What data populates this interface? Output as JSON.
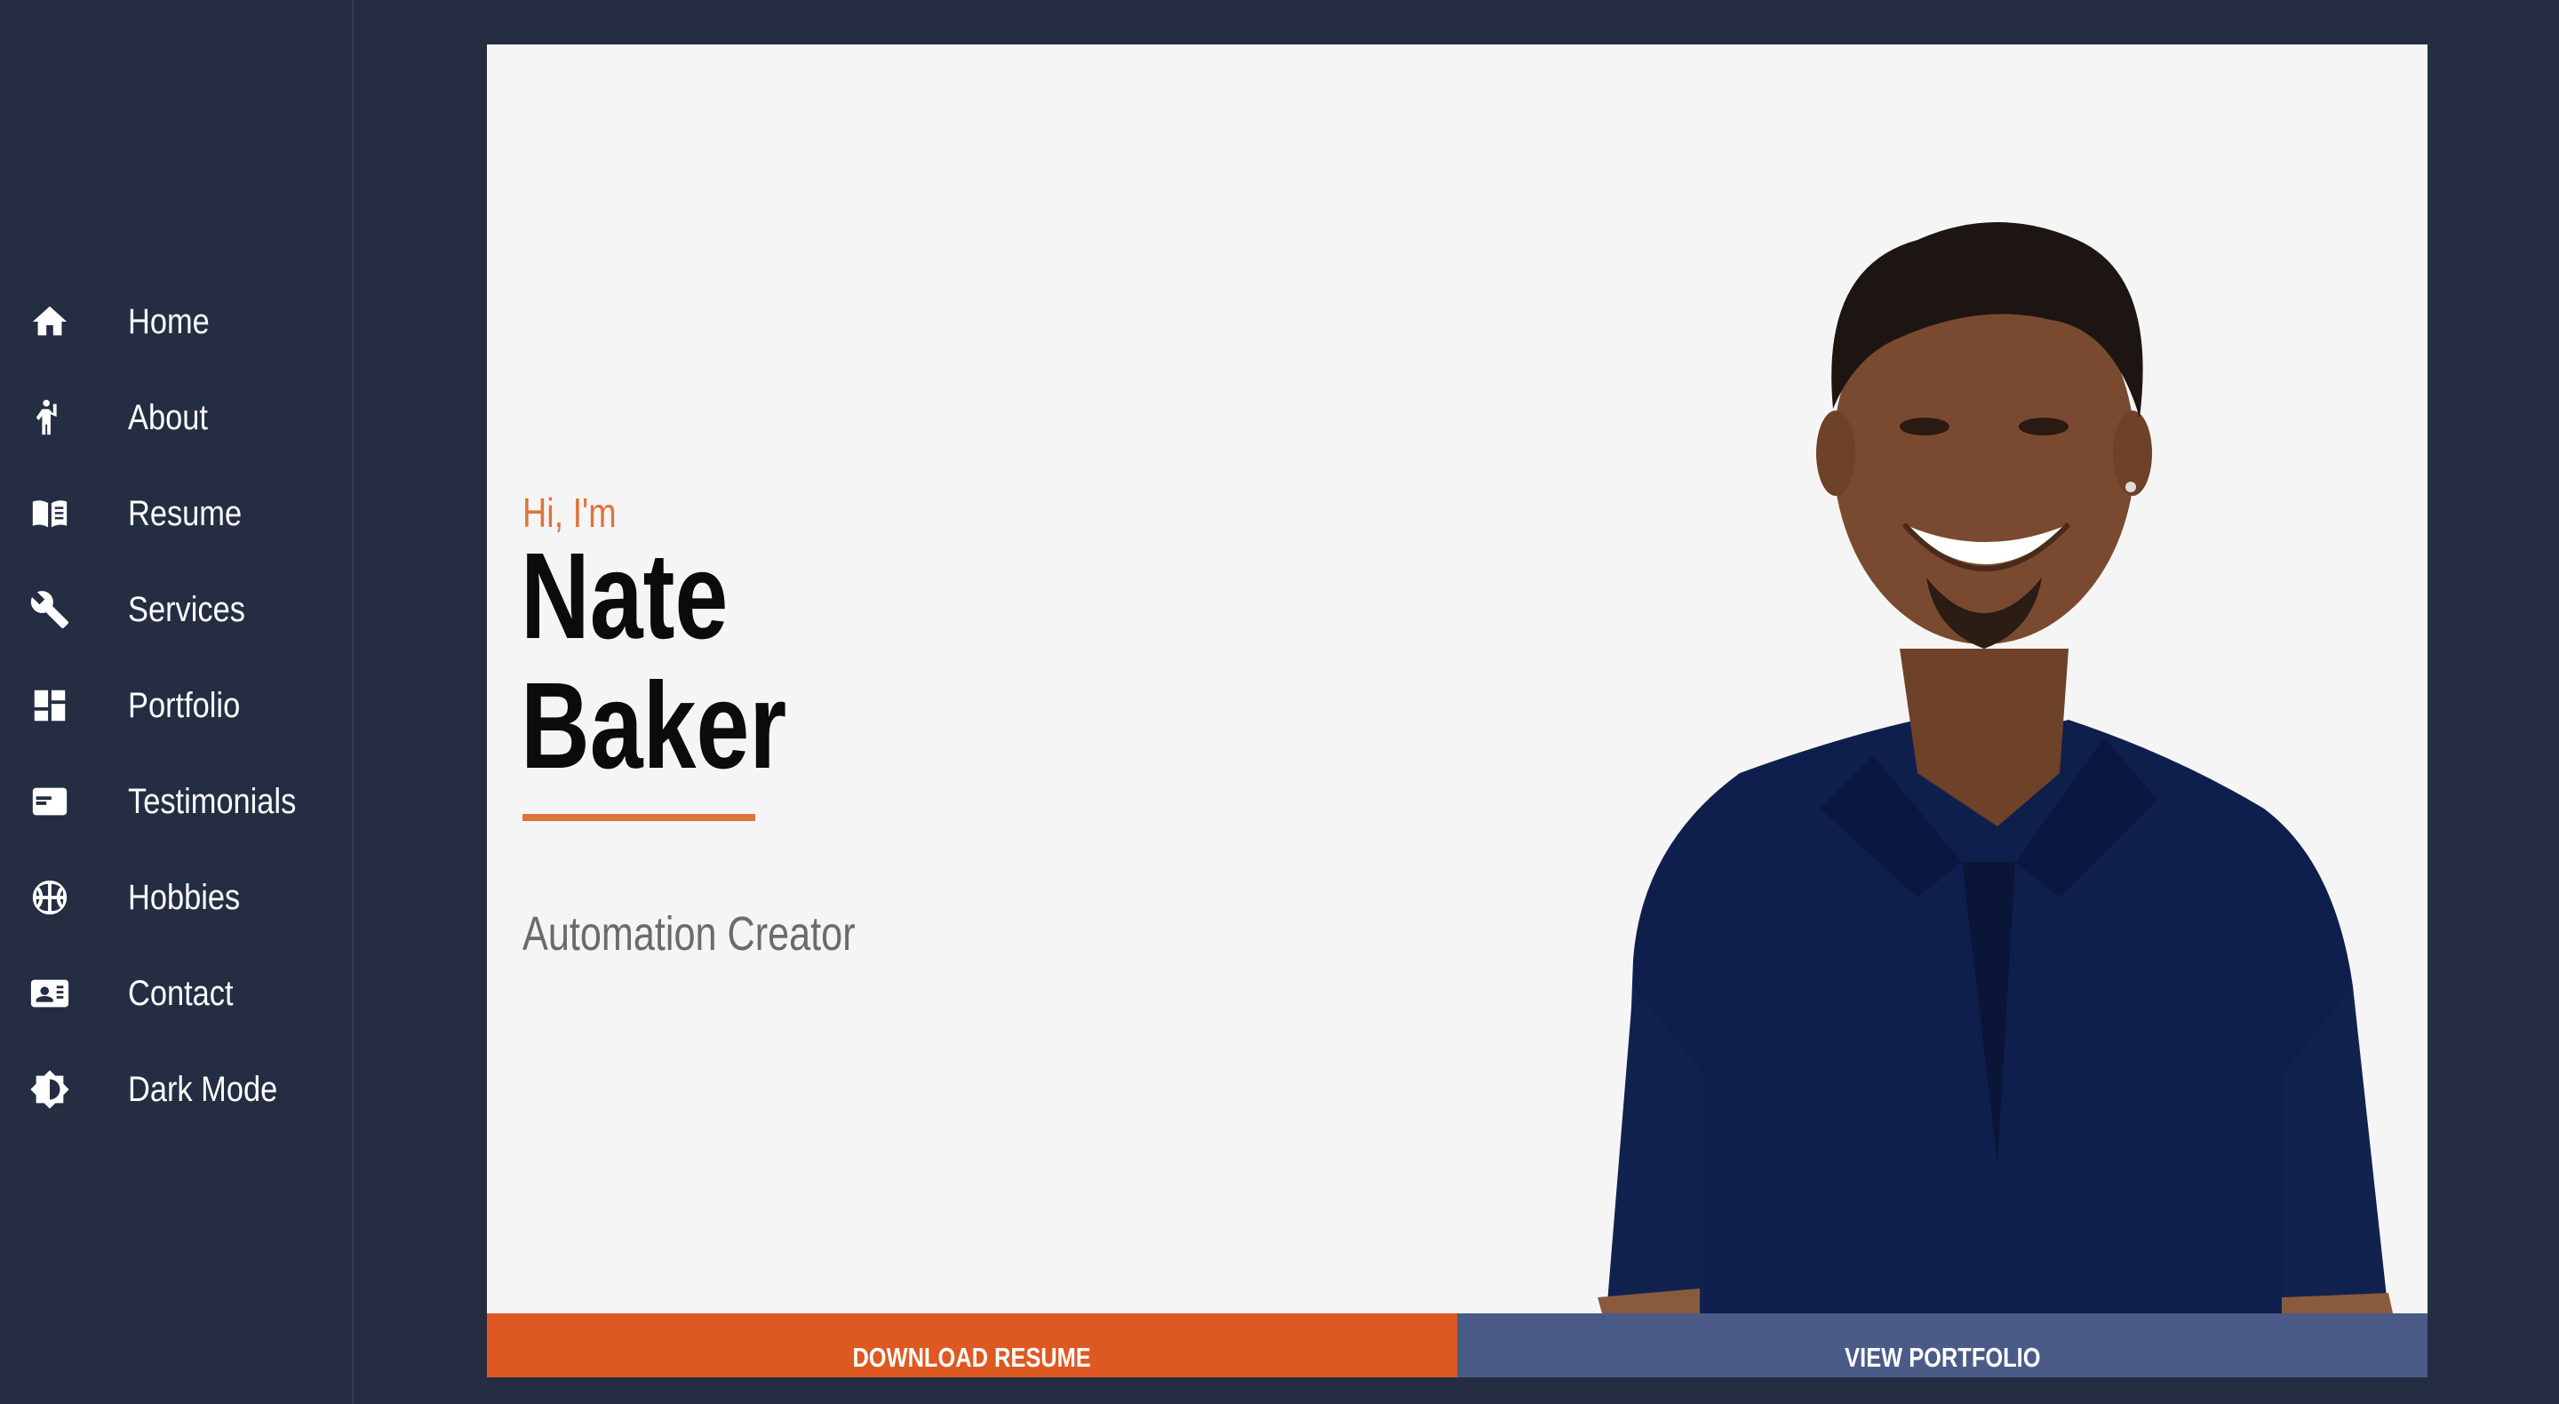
{
  "colors": {
    "background": "#242d42",
    "accent": "#e0733a",
    "download_button": "#de5821",
    "portfolio_button": "#4a5b88",
    "card": "#f5f5f5"
  },
  "sidebar": {
    "items": [
      {
        "label": "Home",
        "icon": "home-icon"
      },
      {
        "label": "About",
        "icon": "person-waving-icon"
      },
      {
        "label": "Resume",
        "icon": "book-icon"
      },
      {
        "label": "Services",
        "icon": "wrench-icon"
      },
      {
        "label": "Portfolio",
        "icon": "dashboard-icon"
      },
      {
        "label": "Testimonials",
        "icon": "card-text-icon"
      },
      {
        "label": "Hobbies",
        "icon": "basketball-icon"
      },
      {
        "label": "Contact",
        "icon": "contact-card-icon"
      },
      {
        "label": "Dark Mode",
        "icon": "brightness-icon"
      }
    ]
  },
  "hero": {
    "greeting": "Hi, I'm",
    "first_name": "Nate",
    "last_name": "Baker",
    "role": "Automation Creator",
    "photo": "portrait-photo"
  },
  "actions": {
    "download_label": "DOWNLOAD RESUME",
    "portfolio_label": "VIEW PORTFOLIO"
  }
}
